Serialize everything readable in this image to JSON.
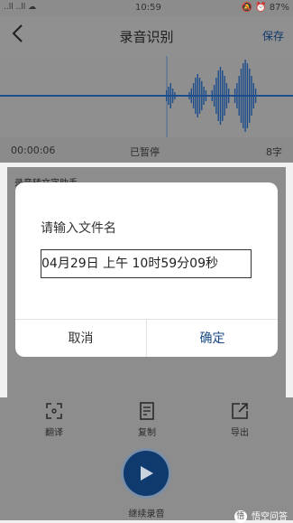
{
  "status_bar": {
    "signal_text": "..ll ..ll ☁",
    "time": "10:59",
    "right_text": "🔕 ⏰ 87%"
  },
  "header": {
    "title": "录音识别",
    "save_label": "保存"
  },
  "recording": {
    "elapsed": "00:00:06",
    "status": "已暂停",
    "char_count": "8字"
  },
  "content": {
    "title": "录音转文字助手"
  },
  "toolbar": {
    "translate_label": "翻译",
    "copy_label": "复制",
    "export_label": "导出",
    "continue_label": "继续录音"
  },
  "dialog": {
    "title": "请输入文件名",
    "filename_value": "04月29日 上午 10时59分09秒",
    "cancel_label": "取消",
    "confirm_label": "确定"
  },
  "watermark": {
    "logo_text": "悟",
    "text": "悟空问答"
  },
  "colors": {
    "accent": "#1a4a86",
    "waveform": "#1c4d8c",
    "overlay": "#8e8e8e"
  }
}
